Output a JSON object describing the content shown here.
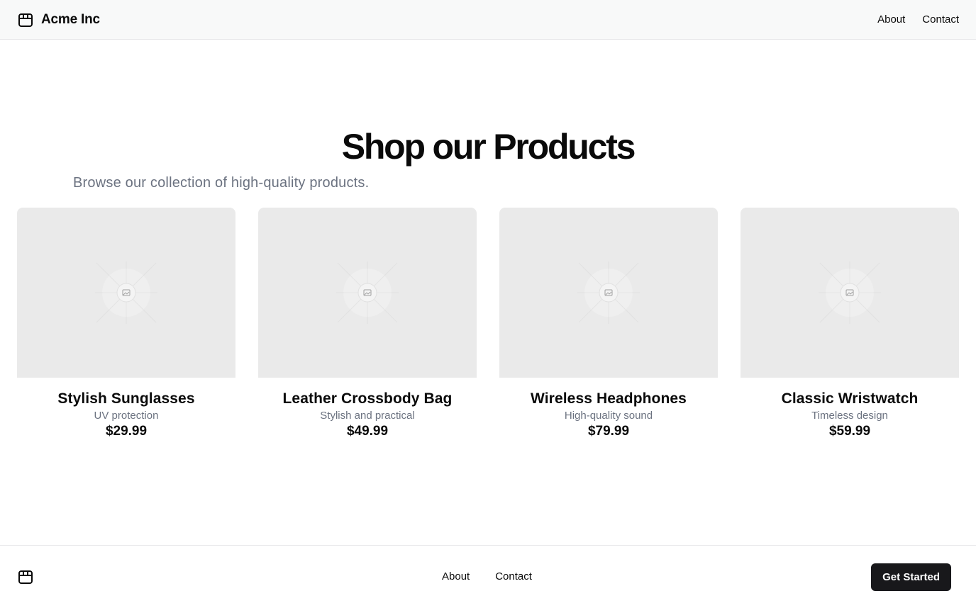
{
  "header": {
    "brand_name": "Acme Inc",
    "logo_icon": "package-icon",
    "nav": [
      {
        "label": "About"
      },
      {
        "label": "Contact"
      }
    ]
  },
  "hero": {
    "title": "Shop our Products",
    "subtitle": "Browse our collection of high-quality products."
  },
  "products": [
    {
      "title": "Stylish Sunglasses",
      "description": "UV protection",
      "price": "$29.99",
      "image_icon": "image-placeholder-icon"
    },
    {
      "title": "Leather Crossbody Bag",
      "description": "Stylish and practical",
      "price": "$49.99",
      "image_icon": "image-placeholder-icon"
    },
    {
      "title": "Wireless Headphones",
      "description": "High-quality sound",
      "price": "$79.99",
      "image_icon": "image-placeholder-icon"
    },
    {
      "title": "Classic Wristwatch",
      "description": "Timeless design",
      "price": "$59.99",
      "image_icon": "image-placeholder-icon"
    }
  ],
  "footer": {
    "logo_icon": "package-icon",
    "nav": [
      {
        "label": "About"
      },
      {
        "label": "Contact"
      }
    ],
    "cta_label": "Get Started"
  },
  "colors": {
    "header_bg": "#f8f9f9",
    "muted_text": "#6b7280",
    "placeholder_bg": "#eaeaea",
    "cta_bg": "#18181b"
  }
}
